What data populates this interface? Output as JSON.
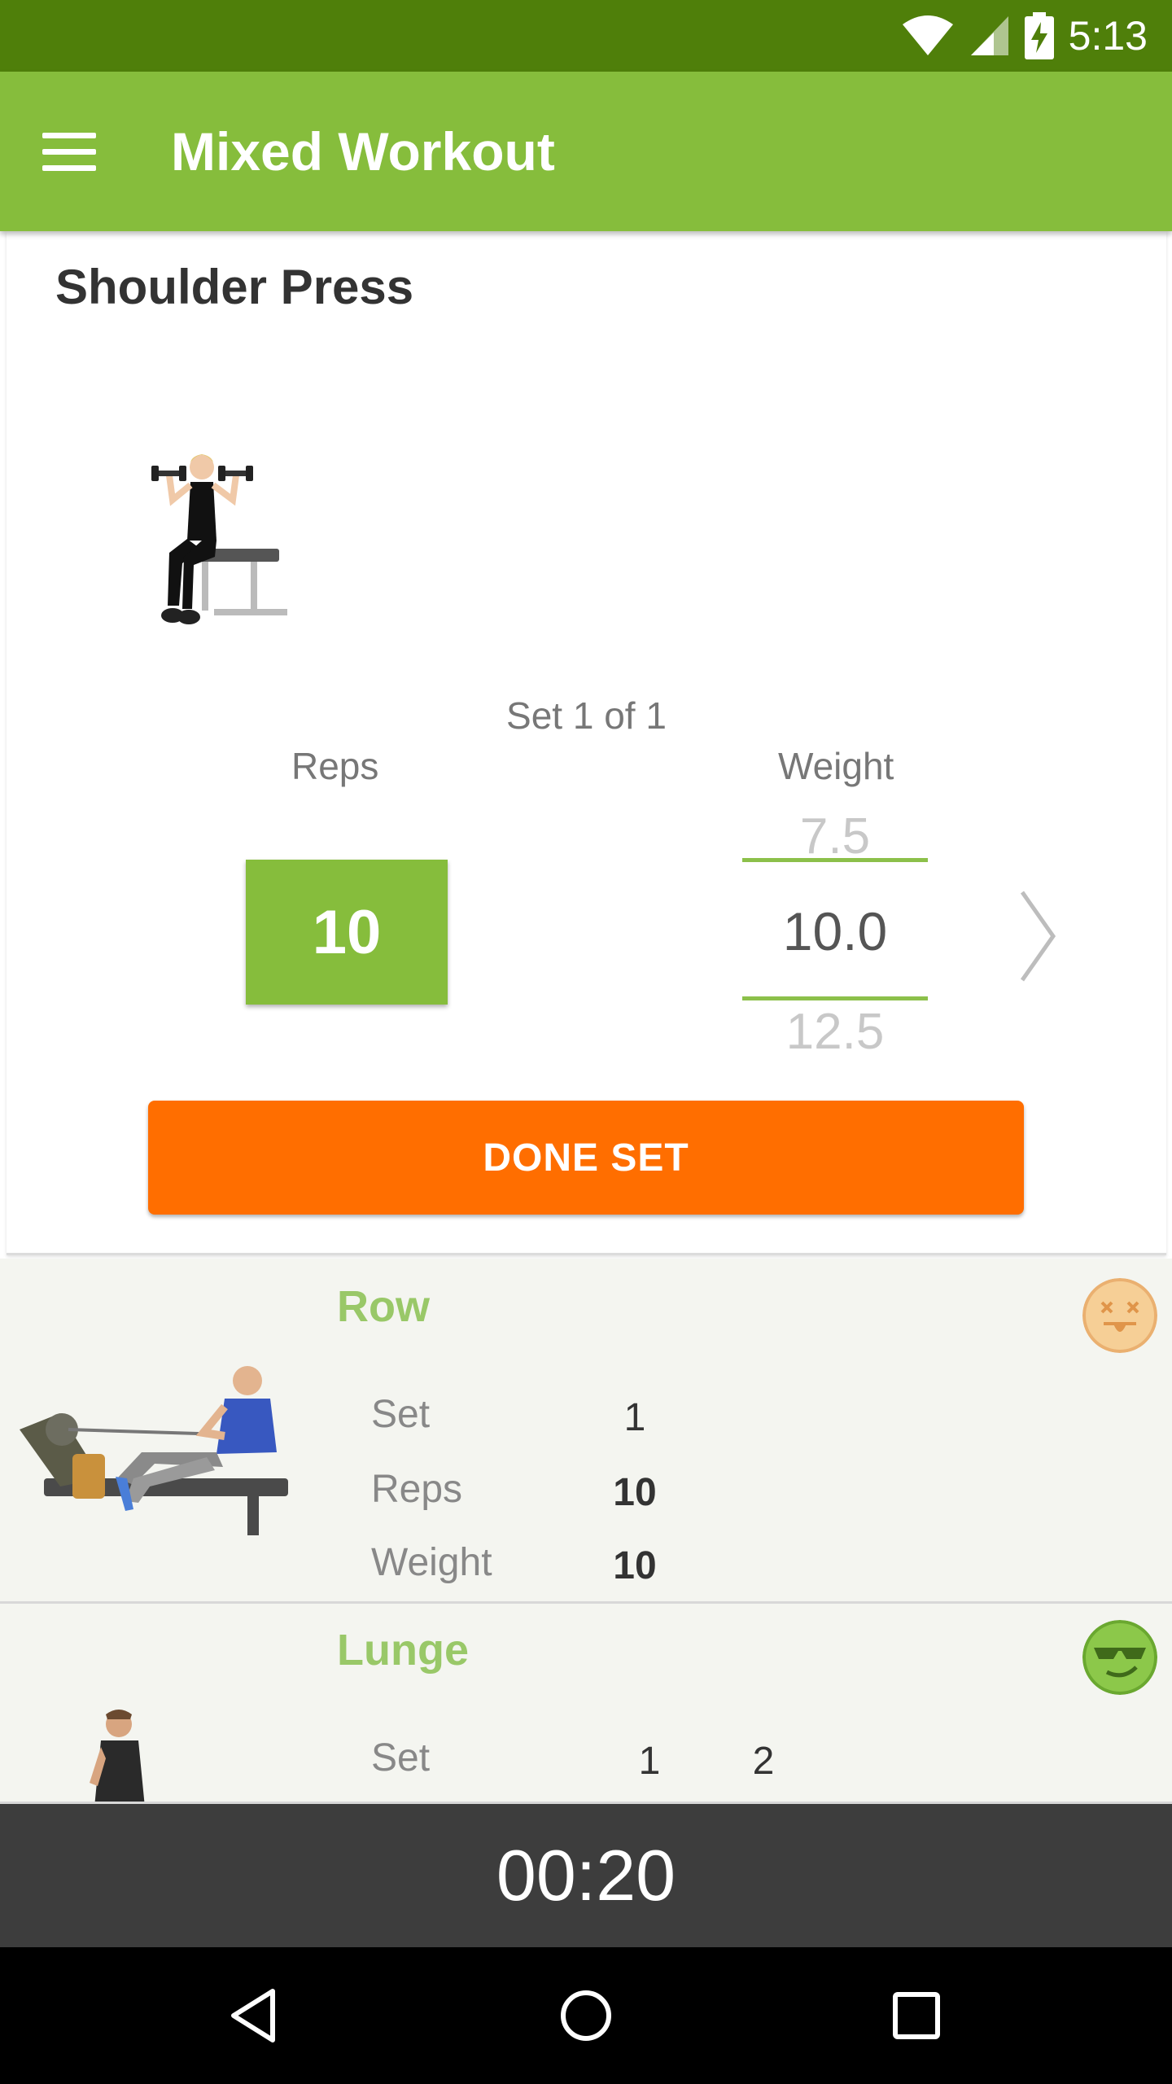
{
  "status_bar": {
    "time": "5:13"
  },
  "app_bar": {
    "title": "Mixed Workout",
    "menu_icon": "hamburger-menu-icon"
  },
  "current_exercise": {
    "name": "Shoulder Press",
    "set_info": "Set 1 of 1",
    "reps_label": "Reps",
    "reps_value": "10",
    "weight_label": "Weight",
    "weight_prev": "7.5",
    "weight_current": "10.0",
    "weight_next": "12.5",
    "done_button": "DONE SET"
  },
  "list": [
    {
      "name": "Row",
      "mood_icon": "dizzy-face-icon",
      "mood_color": "#f5c88e",
      "rows": [
        {
          "label": "Set",
          "values": [
            "1"
          ]
        },
        {
          "label": "Reps",
          "values": [
            "10"
          ]
        },
        {
          "label": "Weight",
          "values": [
            "10"
          ]
        }
      ]
    },
    {
      "name": "Lunge",
      "mood_icon": "cool-sunglasses-face-icon",
      "mood_color": "#8cc84a",
      "rows": [
        {
          "label": "Set",
          "values": [
            "1",
            "2"
          ]
        }
      ]
    }
  ],
  "timer": "00:20",
  "colors": {
    "primary": "#86bd3c",
    "primary_dark": "#4f7f0a",
    "accent": "#ff6e00",
    "timer_bg": "#3d3d3d"
  }
}
